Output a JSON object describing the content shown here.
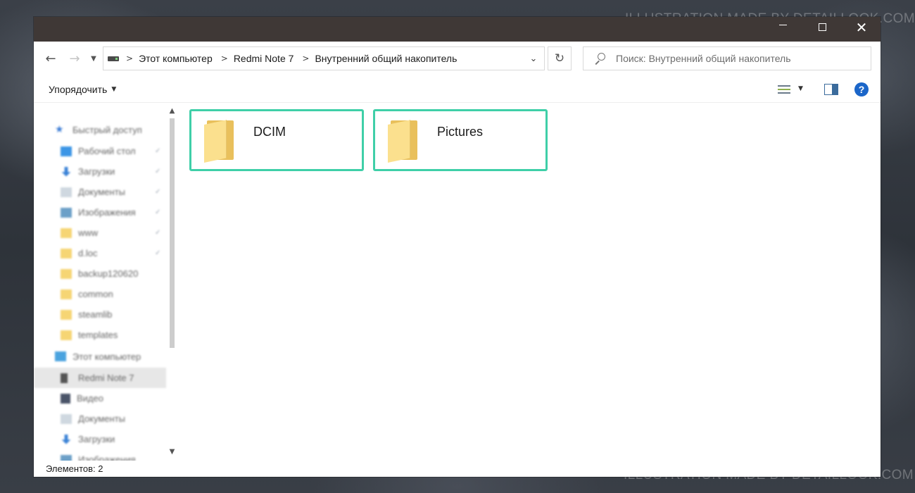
{
  "watermark": {
    "top": "ILLUSTRATION MADE BY DETAILLOOK.COM",
    "bottom": "ILLUSTRATION MADE BY DETAILLOOK.COM"
  },
  "window": {
    "controls": {
      "minimize": "—",
      "maximize": "□",
      "close": "✕"
    }
  },
  "nav": {
    "back_icon": "arrow-left-icon",
    "forward_icon": "arrow-right-icon",
    "recent_icon": "chevron-down-icon",
    "refresh_icon": "refresh-icon"
  },
  "address": {
    "crumbs": [
      "Этот компьютер",
      "Redmi Note 7",
      "Внутренний общий накопитель"
    ]
  },
  "search": {
    "placeholder": "Поиск: Внутренний общий накопитель"
  },
  "command": {
    "organize_label": "Упорядочить"
  },
  "sidebar": {
    "items": [
      {
        "label": "Быстрый доступ",
        "icon": "star-icon"
      },
      {
        "label": "Рабочий стол",
        "icon": "desktop-icon"
      },
      {
        "label": "Загрузки",
        "icon": "download-icon"
      },
      {
        "label": "Документы",
        "icon": "document-icon"
      },
      {
        "label": "Изображения",
        "icon": "image-icon"
      },
      {
        "label": "www",
        "icon": "folder-icon"
      },
      {
        "label": "d.loc",
        "icon": "folder-icon"
      },
      {
        "label": "backup120620",
        "icon": "folder-icon"
      },
      {
        "label": "common",
        "icon": "folder-icon"
      },
      {
        "label": "steamlib",
        "icon": "folder-icon"
      },
      {
        "label": "templates",
        "icon": "folder-icon"
      },
      {
        "label": "Этот компьютер",
        "icon": "computer-icon"
      },
      {
        "label": "Redmi Note 7",
        "icon": "phone-icon"
      },
      {
        "label": "Видео",
        "icon": "video-icon"
      },
      {
        "label": "Документы",
        "icon": "document-icon"
      },
      {
        "label": "Загрузки",
        "icon": "download-icon"
      },
      {
        "label": "Изображения",
        "icon": "image-icon"
      }
    ]
  },
  "content": {
    "folders": [
      {
        "name": "DCIM"
      },
      {
        "name": "Pictures"
      }
    ]
  },
  "status": {
    "count_label": "Элементов: 2"
  },
  "colors": {
    "accent_highlight": "#3fcfa8",
    "titlebar": "#3f3836",
    "help_blue": "#1b66c9"
  }
}
